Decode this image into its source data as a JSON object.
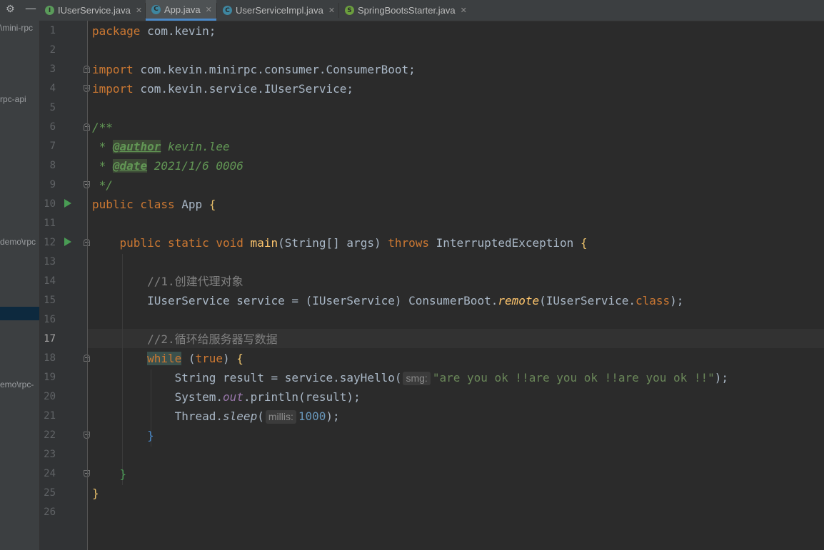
{
  "sidebar": {
    "items": [
      "\\mini-rpc",
      "rpc-api",
      "demo\\rpc",
      "emo\\rpc-"
    ]
  },
  "tabs": [
    {
      "label": "IUserService.java",
      "icon": "I",
      "icon_color": "#5a9b5a",
      "active": false
    },
    {
      "label": "App.java",
      "icon": "C",
      "icon_color": "#3e86a0",
      "active": true
    },
    {
      "label": "UserServiceImpl.java",
      "icon": "C",
      "icon_color": "#3e86a0",
      "active": false
    },
    {
      "label": "SpringBootsStarter.java",
      "icon": "S",
      "icon_color": "#6b9e3e",
      "active": false
    }
  ],
  "gutter": {
    "line_numbers": [
      "1",
      "2",
      "3",
      "4",
      "5",
      "6",
      "7",
      "8",
      "9",
      "10",
      "11",
      "12",
      "13",
      "14",
      "15",
      "16",
      "17",
      "18",
      "19",
      "20",
      "21",
      "22",
      "23",
      "24",
      "25",
      "26"
    ],
    "current_line": "17"
  },
  "code": {
    "l1_kw": "package",
    "l1_rest": " com.kevin;",
    "l3_kw": "import",
    "l3_rest": " com.kevin.minirpc.consumer.ConsumerBoot;",
    "l4_kw": "import",
    "l4_rest": " com.kevin.service.IUserService;",
    "l6": "/**",
    "l7_star": " * ",
    "l7_tag": "@author",
    "l7_val": " kevin.lee",
    "l8_star": " * ",
    "l8_tag": "@date",
    "l8_val": " 2021/1/6 0006",
    "l9": " */",
    "l10_kw": "public class",
    "l10_name": " App ",
    "l10_brace": "{",
    "l12_kw": "    public static void",
    "l12_fn": " main",
    "l12_args": "(String[] args) ",
    "l12_throws": "throws",
    "l12_exc": " InterruptedException ",
    "l12_brace": "{",
    "l14": "        //1.创建代理对象",
    "l15_a": "        IUserService service = (IUserService) ConsumerBoot.",
    "l15_fn": "remote",
    "l15_b": "(IUserService.",
    "l15_kw": "class",
    "l15_c": ");",
    "l17": "        //2.循环给服务器写数据",
    "l18_indent": "        ",
    "l18_while": "while",
    "l18_a": " (",
    "l18_true": "true",
    "l18_b": ") ",
    "l18_brace": "{",
    "l19_a": "            String result = service.sayHello(",
    "l19_hint": "smg:",
    "l19_str": "\"are you ok !!are you ok !!are you ok !!\"",
    "l19_b": ");",
    "l20_a": "            System.",
    "l20_field": "out",
    "l20_b": ".println(result);",
    "l21_a": "            Thread.",
    "l21_fn": "sleep",
    "l21_b": "(",
    "l21_hint": "millis:",
    "l21_num": "1000",
    "l21_c": ");",
    "l22": "        }",
    "l24": "    }",
    "l25": "}"
  }
}
